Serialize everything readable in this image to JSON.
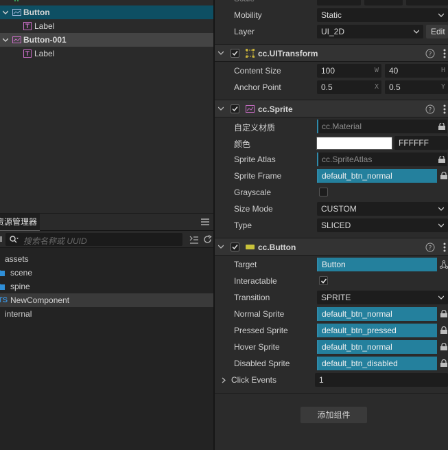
{
  "hierarchy": {
    "nodes": [
      {
        "label": "Button",
        "depth": 0,
        "expanded": true,
        "selected": true,
        "icon": "button-node-icon"
      },
      {
        "label": "Label",
        "depth": 1,
        "icon": "label-node-icon"
      },
      {
        "label": "Button-001",
        "depth": 0,
        "expanded": true,
        "highlighted": true,
        "icon": "button-node-icon"
      },
      {
        "label": "Label",
        "depth": 1,
        "icon": "label-node-icon"
      }
    ]
  },
  "assets": {
    "tab_label": "资源管理器",
    "search_placeholder": "搜索名称或 UUID",
    "items": [
      {
        "label": "assets",
        "icon": "none"
      },
      {
        "label": "scene",
        "icon": "folder-icon"
      },
      {
        "label": "spine",
        "icon": "folder-icon"
      },
      {
        "label": "NewComponent",
        "icon": "typescript-icon",
        "icon_text": "TS",
        "selected": true
      },
      {
        "label": "internal",
        "icon": "none"
      }
    ]
  },
  "inspector": {
    "node": {
      "mobility_label": "Mobility",
      "mobility_value": "Static",
      "layer_label": "Layer",
      "layer_value": "UI_2D",
      "edit_label": "Edit"
    },
    "ui_transform": {
      "title": "cc.UITransform",
      "content_size_label": "Content Size",
      "width": "100",
      "width_unit": "W",
      "height": "40",
      "height_unit": "H",
      "anchor_label": "Anchor Point",
      "anchor_x": "0.5",
      "anchor_x_unit": "X",
      "anchor_y": "0.5",
      "anchor_y_unit": "Y"
    },
    "sprite": {
      "title": "cc.Sprite",
      "custom_material_label": "自定义材质",
      "custom_material_value": "cc.Material",
      "color_label": "颜色",
      "color_hex": "FFFFFF",
      "color_swatch": "#ffffff",
      "sprite_atlas_label": "Sprite Atlas",
      "sprite_atlas_value": "cc.SpriteAtlas",
      "sprite_frame_label": "Sprite Frame",
      "sprite_frame_value": "default_btn_normal",
      "grayscale_label": "Grayscale",
      "grayscale": false,
      "size_mode_label": "Size Mode",
      "size_mode_value": "CUSTOM",
      "type_label": "Type",
      "type_value": "SLICED"
    },
    "button": {
      "title": "cc.Button",
      "target_label": "Target",
      "target_value": "Button",
      "interactable_label": "Interactable",
      "interactable": true,
      "transition_label": "Transition",
      "transition_value": "SPRITE",
      "normal_sprite_label": "Normal Sprite",
      "normal_sprite_value": "default_btn_normal",
      "pressed_sprite_label": "Pressed Sprite",
      "pressed_sprite_value": "default_btn_pressed",
      "hover_sprite_label": "Hover Sprite",
      "hover_sprite_value": "default_btn_normal",
      "disabled_sprite_label": "Disabled Sprite",
      "disabled_sprite_value": "default_btn_disabled",
      "click_events_label": "Click Events",
      "click_events_count": "1"
    },
    "add_component_label": "添加组件"
  },
  "colors": {
    "accent": "#24809d",
    "selection": "#0e4f63",
    "panel": "#2b2b2b"
  }
}
